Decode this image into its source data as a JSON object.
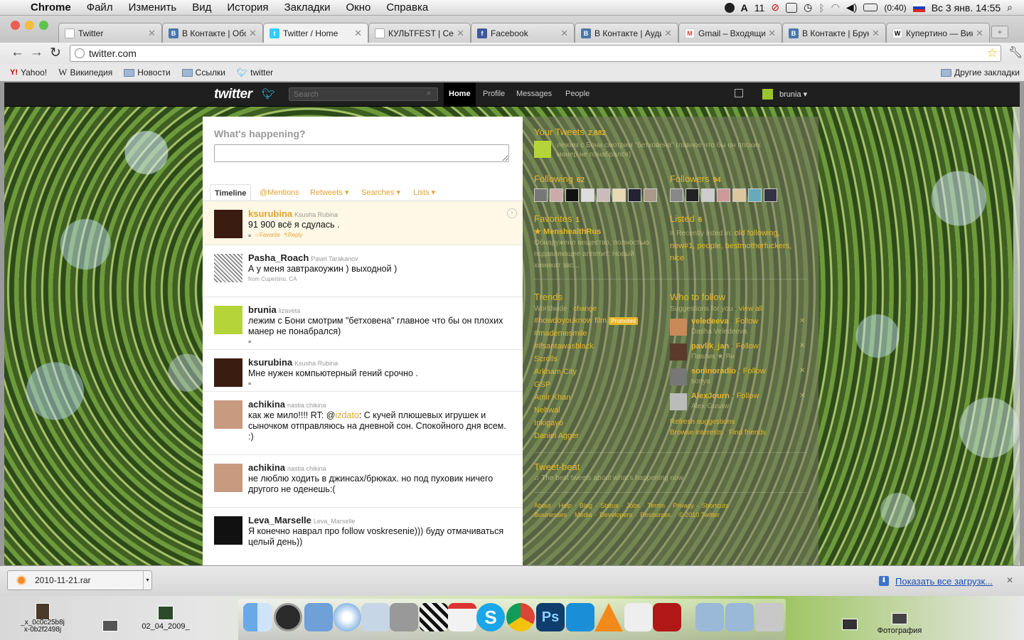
{
  "menubar": {
    "apple": "",
    "app": "Chrome",
    "items": [
      "Файл",
      "Изменить",
      "Вид",
      "История",
      "Закладки",
      "Окно",
      "Справка"
    ],
    "status": {
      "badge": "11",
      "battery": "(0:40)",
      "datetime": "Вс 3 янв.  14:55"
    }
  },
  "tabs": [
    {
      "title": "Twitter",
      "icon": "page-icon",
      "color": "#ffffff"
    },
    {
      "title": "В Контакте | Обсу",
      "icon": "vk-icon",
      "color": "#4a76a8"
    },
    {
      "title": "Twitter / Home",
      "icon": "twitter-bird-icon",
      "color": "#33ccff"
    },
    {
      "title": "КУЛЬТFEST | Сери",
      "icon": "page-icon",
      "color": "#ffffff"
    },
    {
      "title": "Facebook",
      "icon": "facebook-icon",
      "color": "#3b5998"
    },
    {
      "title": "В Контакте | Ауди",
      "icon": "vk-icon",
      "color": "#4a76a8"
    },
    {
      "title": "Gmail – Входящие",
      "icon": "gmail-icon",
      "color": "#d44638"
    },
    {
      "title": "В Контакте | Брун",
      "icon": "vk-icon",
      "color": "#4a76a8"
    },
    {
      "title": "Купертино — Вики",
      "icon": "wikipedia-icon",
      "color": "#ffffff"
    }
  ],
  "toolbar": {
    "url": "twitter.com"
  },
  "bookmarks": {
    "items": [
      {
        "label": "Yahoo!",
        "icon": "yahoo-icon"
      },
      {
        "label": "Википедия",
        "icon": "wikipedia-icon"
      },
      {
        "label": "Новости",
        "icon": "folder-icon"
      },
      {
        "label": "Ссылки",
        "icon": "folder-icon"
      },
      {
        "label": "twitter",
        "icon": "twitter-bird-icon"
      }
    ],
    "other": "Другие закладки"
  },
  "twitter": {
    "logo": "twitter",
    "search_placeholder": "Search",
    "nav": [
      "Home",
      "Profile",
      "Messages",
      "People"
    ],
    "user": "brunia",
    "whats_happening": "What's happening?",
    "stream_tabs": [
      "Timeline",
      "@Mentions",
      "Retweets",
      "Searches",
      "Lists"
    ],
    "tweets": [
      {
        "user": "ksurubina",
        "name": "Ksusha Rubina",
        "text": "91 900 всё я сдулась .",
        "actions": [
          "Favorite",
          "Reply"
        ],
        "highlight": true
      },
      {
        "user": "Pasha_Roach",
        "name": "Pavel Tarakanov",
        "text": "А у меня завтракоужин ) выходной )",
        "meta": "from Cupertino, CA"
      },
      {
        "user": "brunia",
        "name": "lizaveta",
        "text": "лежим с Бони смотрим \"бетховена\" главное что бы он плохих манер не понабрался)"
      },
      {
        "user": "ksurubina",
        "name": "Ksusha Rubina",
        "text": "Мне нужен компьютерный гений срочно ."
      },
      {
        "user": "achikina",
        "name": "nastia chikina",
        "text_pre": "как же мило!!!! RT: @",
        "mention": "izdato",
        "text_post": ": С кучей плюшевых игрушек и сыночком отправляюсь на дневной сон. Спокойного дня всем. :)"
      },
      {
        "user": "achikina",
        "name": "nastia chikina",
        "text": "не люблю ходить в джинсах/брюках. но под пуховик ничего другого не оденешь:("
      },
      {
        "user": "Leva_Marselle",
        "name": "Leva_Marselle",
        "text": "Я конечно наврал про follow voskresenie))) буду отмачиваться целый день))"
      }
    ],
    "sidebar": {
      "your_tweets": "Your Tweets",
      "your_tweets_count": "2,882",
      "last_tweet": "лежим с Бони смотрим \"бетховена\" главное что бы он плохих манер не понабрался)",
      "following": "Following",
      "following_count": "62",
      "followers": "Followers",
      "followers_count": "94",
      "favorites": "Favorites",
      "favorites_count": "1",
      "fav_user": "MenshealthRus",
      "fav_text": "Обнаружено вещество, полностью подавляющее аппетит: Новый химикат зас...",
      "listed": "Listed",
      "listed_count": "6",
      "listed_prefix": "Recently listed in:",
      "listed_text": "old following, new#1, people, bestmotherfuckers, nice",
      "trends": "Trends",
      "trends_sub": "Worldwide",
      "trends_change": "change",
      "trend_items": [
        "#howdoyouknow film",
        "#mademesmile",
        "#ifsantawasblack",
        "Scrolls",
        "Arkham City",
        "GSP",
        "Amir Khan",
        "Nehwal",
        "Inkigayo",
        "Daniel Agger"
      ],
      "promoted": "Promoted",
      "who_to_follow": "Who to follow",
      "wtf_sub": "Suggestions for you",
      "wtf_viewall": "view all",
      "suggestions": [
        {
          "user": "veledeeva",
          "name": "Dasha Veledeeva"
        },
        {
          "user": "pavlik_jan",
          "name": "Павлик ★ Ян"
        },
        {
          "user": "soninoradio",
          "name": "sonya"
        },
        {
          "user": "AlexJourn",
          "name": "Alex Gusaw"
        }
      ],
      "follow": "Follow",
      "refresh": "Refresh suggestions",
      "browse": "Browse interests",
      "find": "Find friends",
      "tweetbeat": "Tweet-beat",
      "tweetbeat_sub": "The best tweets about what's happening now",
      "footer1": [
        "About",
        "Help",
        "Blog",
        "Status",
        "Jobs",
        "Terms",
        "Privacy",
        "Shortcuts"
      ],
      "footer2": [
        "Businesses",
        "Media",
        "Developers",
        "Resources",
        "© 2010 Twitter"
      ]
    }
  },
  "downloads": {
    "file": "2010-11-21.rar",
    "show_all": "Показать все загрузк..."
  },
  "desktop": {
    "items": [
      "_x_0c0c25b8j",
      "x-0b2f2498j",
      "02_04_2009_"
    ],
    "right_items": [
      "Фотография"
    ]
  }
}
